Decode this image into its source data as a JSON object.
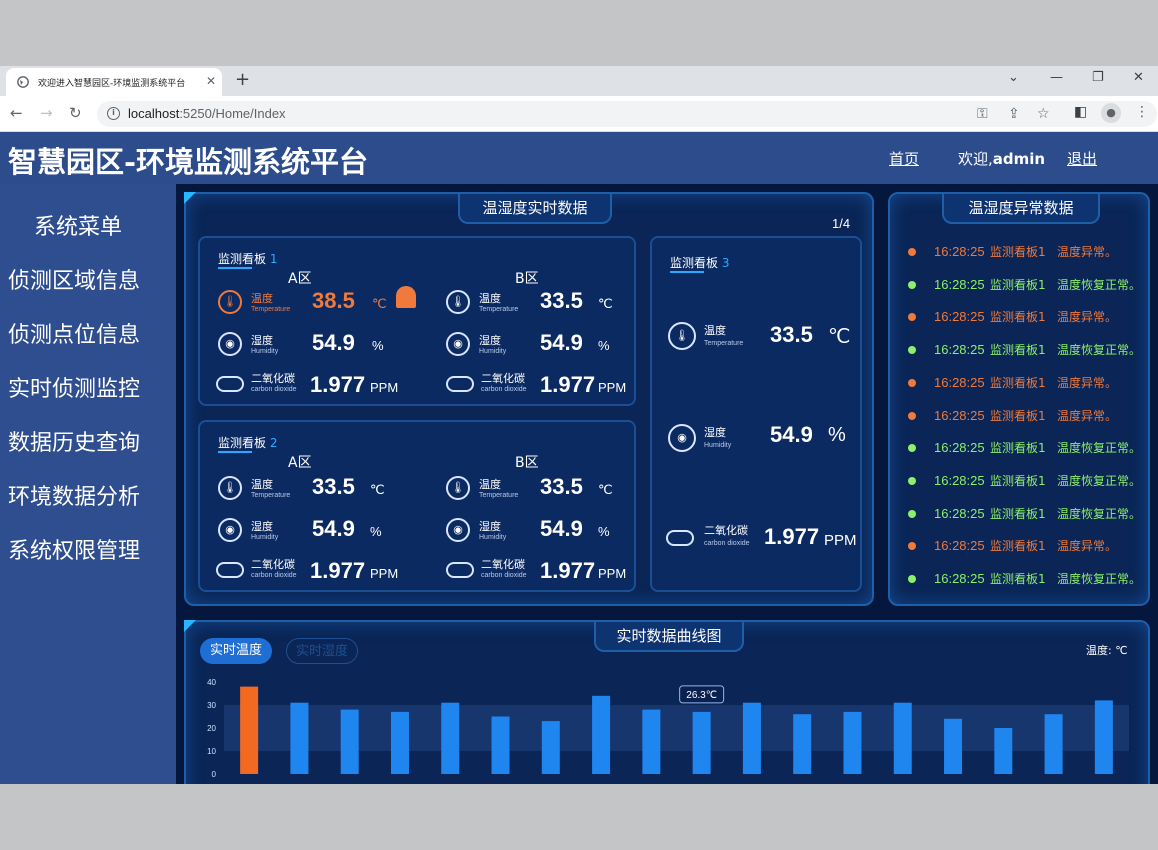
{
  "browser": {
    "tab_title": "欢迎进入智慧园区-环境监测系统平台",
    "url_host": "localhost",
    "url_rest": ":5250/Home/Index"
  },
  "header": {
    "title": "智慧园区-环境监测系统平台",
    "home_link": "首页",
    "welcome_prefix": "欢迎,",
    "username": "admin",
    "logout_link": "退出"
  },
  "sidebar": {
    "title": "系统菜单",
    "items": [
      {
        "label": "侦测区域信息"
      },
      {
        "label": "侦测点位信息"
      },
      {
        "label": "实时侦测监控"
      },
      {
        "label": "数据历史查询"
      },
      {
        "label": "环境数据分析"
      },
      {
        "label": "系统权限管理"
      }
    ]
  },
  "realtime": {
    "title": "温湿度实时数据",
    "page_indicator": "1/4",
    "labels": {
      "temp": "温度",
      "temp_en": "Temperature",
      "humid": "湿度",
      "humid_en": "Humidity",
      "co2": "二氧化碳",
      "co2_en": "carbon dioxide",
      "unit_temp": "℃",
      "unit_humid": "%",
      "unit_co2": "PPM"
    },
    "boards": [
      {
        "name": "监测看板",
        "num": "1",
        "zones": [
          {
            "zone": "A区",
            "temp": "38.5",
            "humid": "54.9",
            "co2": "1.977",
            "alarm": true
          },
          {
            "zone": "B区",
            "temp": "33.5",
            "humid": "54.9",
            "co2": "1.977",
            "alarm": false
          }
        ]
      },
      {
        "name": "监测看板",
        "num": "2",
        "zones": [
          {
            "zone": "A区",
            "temp": "33.5",
            "humid": "54.9",
            "co2": "1.977",
            "alarm": false
          },
          {
            "zone": "B区",
            "temp": "33.5",
            "humid": "54.9",
            "co2": "1.977",
            "alarm": false
          }
        ]
      },
      {
        "name": "监测看板",
        "num": "3",
        "zones": [
          {
            "zone": "",
            "temp": "33.5",
            "humid": "54.9",
            "co2": "1.977",
            "alarm": false
          }
        ]
      }
    ]
  },
  "alerts": {
    "title": "温湿度异常数据",
    "colors": {
      "abnormal": "#f07a3b",
      "recovered": "#8df06a"
    },
    "rows": [
      {
        "time": "16:28:25",
        "board": "监测看板1",
        "msg": "温度异常。",
        "status": "abnormal"
      },
      {
        "time": "16:28:25",
        "board": "监测看板1",
        "msg": "温度恢复正常。",
        "status": "recovered"
      },
      {
        "time": "16:28:25",
        "board": "监测看板1",
        "msg": "温度异常。",
        "status": "abnormal"
      },
      {
        "time": "16:28:25",
        "board": "监测看板1",
        "msg": "温度恢复正常。",
        "status": "recovered"
      },
      {
        "time": "16:28:25",
        "board": "监测看板1",
        "msg": "温度异常。",
        "status": "abnormal"
      },
      {
        "time": "16:28:25",
        "board": "监测看板1",
        "msg": "温度异常。",
        "status": "abnormal"
      },
      {
        "time": "16:28:25",
        "board": "监测看板1",
        "msg": "温度恢复正常。",
        "status": "recovered"
      },
      {
        "time": "16:28:25",
        "board": "监测看板1",
        "msg": "温度恢复正常。",
        "status": "recovered"
      },
      {
        "time": "16:28:25",
        "board": "监测看板1",
        "msg": "温度恢复正常。",
        "status": "recovered"
      },
      {
        "time": "16:28:25",
        "board": "监测看板1",
        "msg": "温度异常。",
        "status": "abnormal"
      },
      {
        "time": "16:28:25",
        "board": "监测看板1",
        "msg": "温度恢复正常。",
        "status": "recovered"
      }
    ]
  },
  "curve": {
    "title": "实时数据曲线图",
    "tabs": [
      "实时温度",
      "实时湿度"
    ],
    "unit_label": "温度: ℃"
  },
  "chart_data": {
    "type": "bar",
    "ylim": [
      0,
      40
    ],
    "yticks": [
      0,
      10,
      20,
      30,
      40
    ],
    "values": [
      38,
      31,
      28,
      27,
      31,
      25,
      23,
      34,
      28,
      27,
      31,
      26,
      27,
      31,
      24,
      20,
      26,
      32
    ],
    "highlight_index": 0,
    "highlight_color": "#f26a21",
    "bar_color": "#1f86f0",
    "tooltip_index": 9,
    "tooltip_text": "26.3℃"
  }
}
